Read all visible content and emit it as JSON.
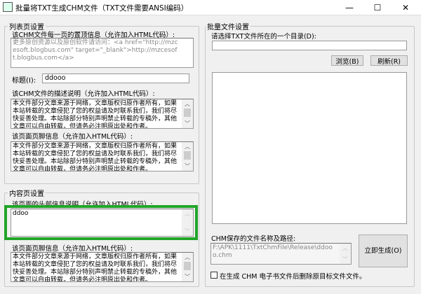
{
  "window": {
    "title": "批量将TXT生成CHM文件（TXT文件需要ANSI编码）",
    "minimize": "—",
    "maximize": "☐",
    "close": "✕"
  },
  "list_group": {
    "title": "列表页设置",
    "top_label": "该CHM文件每一页的置顶信息（允许加入HTML代码）:",
    "top_value": "更多原创资源以及原创软件请访问：<a href=\"http://mzcesoft.blogbus.com\" target=\"_blank\">http://mzcesoft.blogbus.com</a>",
    "title_label": "标题(I):",
    "title_value": "ddooo",
    "desc_label": "该CHM文件的描述说明（允许加入HTML代码）:",
    "desc_value": "本文件部分文章来源于网络，文章版权归原作者所有，如果本站转载的文章侵犯了您的权益请及时联系我们，我们将尽快妥善处理。本站除部分特别声明禁止转载的专稿外，其他文章可以自由转载，但请务必注明原出处和作者。",
    "footer_label": "该页面页脚信息（允许加入HTML代码）:",
    "footer_value": "本文件部分文章来源于网络，文章版权归原作者所有，如果本站转载的文章侵犯了您的权益请及时联系我们，我们将尽快妥善处理。本站除部分特别声明禁止转载的专稿外，其他文章可以自由转载，但请务必注明原出处和作者。"
  },
  "content_group": {
    "title": "内容页设置",
    "header_label": "该页面的头部信息说明（允许加入HTML代码）:",
    "header_value": "ddoo",
    "footer_label": "该页面页脚信息（允许加入HTML代码）:",
    "footer_value": "本文件部分文章来源于网络，文章版权归原作者所有，如果本站转载的文章侵犯了您的权益请及时联系我们，我们将尽快妥善处理。本站除部分特别声明禁止转载的专稿外，其他文章可以自由转载，但请务必注明原出处和作者。"
  },
  "batch_group": {
    "title": "批量文件设置",
    "dir_label": "请选择TXT文件所在的一个目录(D):",
    "dir_value": "",
    "browse": "浏览(B)",
    "refresh": "刷新(R)",
    "save_label": "CHM保存的文件名称及路径:",
    "save_value": "F:\\APK\\1111\\TxtChmFile\\Release\\ddooo.chm",
    "generate": "立即生成(O)",
    "delete_checkbox": "在生成 CHM 电子书文件后删除原目标文件文件。"
  },
  "highlight_color": "#22a52a",
  "scroll": {
    "up": "︿",
    "down": "﹀"
  }
}
